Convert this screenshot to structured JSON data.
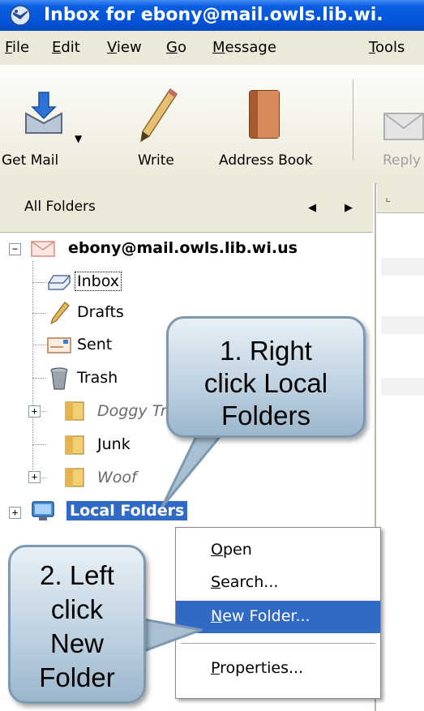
{
  "window": {
    "title": "Inbox for ebony@mail.owls.lib.wi."
  },
  "menu": {
    "items": [
      {
        "label": "File",
        "u": "F",
        "rest": "ile"
      },
      {
        "label": "Edit",
        "u": "E",
        "rest": "dit"
      },
      {
        "label": "View",
        "u": "V",
        "rest": "iew"
      },
      {
        "label": "Go",
        "u": "G",
        "rest": "o"
      },
      {
        "label": "Message",
        "u": "M",
        "rest": "essage"
      },
      {
        "label": "Tools",
        "u": "T",
        "rest": "ools"
      }
    ]
  },
  "toolbar": {
    "get_mail": "Get Mail",
    "write": "Write",
    "address_book": "Address Book",
    "reply": "Reply"
  },
  "folder_pane": {
    "header": "All Folders",
    "account": "ebony@mail.owls.lib.wi.us",
    "folders": [
      "Inbox",
      "Drafts",
      "Sent",
      "Trash",
      "Doggy Treats",
      "Junk",
      "Woof"
    ],
    "local_folders": "Local Folders"
  },
  "context_menu": {
    "items": [
      {
        "u": "O",
        "rest": "pen"
      },
      {
        "u": "S",
        "rest": "earch..."
      },
      {
        "u": "N",
        "rest": "ew Folder..."
      },
      {
        "u": "P",
        "rest": "roperties..."
      }
    ],
    "highlighted": "New Folder...",
    "highlight_color": "#316ac5"
  },
  "callouts": {
    "step1": [
      "1. Right",
      "click Local",
      "Folders"
    ],
    "step2": [
      "2. Left",
      "click",
      "New",
      "Folder"
    ]
  },
  "colors": {
    "titlebar": "#0453d8",
    "selection": "#316ac5",
    "callout_border": "#7d99b2"
  }
}
